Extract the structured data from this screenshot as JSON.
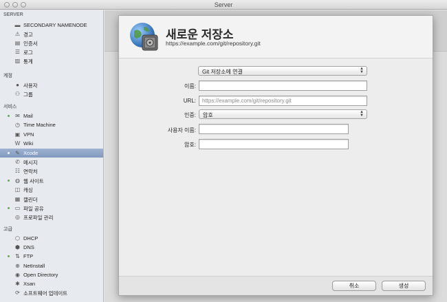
{
  "window": {
    "title": "Server"
  },
  "sidebar": {
    "server_header": "SERVER",
    "server_items": [
      {
        "label": "SECONDARY NAMENODE",
        "icon": "server-icon"
      },
      {
        "label": "경고",
        "icon": "alerts-icon"
      },
      {
        "label": "인증서",
        "icon": "certificates-icon"
      },
      {
        "label": "로그",
        "icon": "logs-icon"
      },
      {
        "label": "통계",
        "icon": "stats-icon"
      }
    ],
    "accounts_header": "계정",
    "accounts_items": [
      {
        "label": "사용자",
        "icon": "user-icon"
      },
      {
        "label": "그룹",
        "icon": "group-icon"
      }
    ],
    "services_header": "서비스",
    "services_items": [
      {
        "label": "Mail",
        "icon": "mail-icon",
        "active": true
      },
      {
        "label": "Time Machine",
        "icon": "time-machine-icon",
        "active": false
      },
      {
        "label": "VPN",
        "icon": "vpn-icon",
        "active": false
      },
      {
        "label": "Wiki",
        "icon": "wiki-icon",
        "active": false
      },
      {
        "label": "Xcode",
        "icon": "xcode-icon",
        "active": true,
        "selected": true
      },
      {
        "label": "메시지",
        "icon": "messages-icon",
        "active": false
      },
      {
        "label": "연락처",
        "icon": "contacts-icon",
        "active": false
      },
      {
        "label": "웹 사이트",
        "icon": "websites-icon",
        "active": true
      },
      {
        "label": "캐싱",
        "icon": "caching-icon",
        "active": false
      },
      {
        "label": "캘린더",
        "icon": "calendar-icon",
        "active": false
      },
      {
        "label": "파일 공유",
        "icon": "file-sharing-icon",
        "active": true
      },
      {
        "label": "프로파일 관리",
        "icon": "profile-manager-icon",
        "active": false
      }
    ],
    "advanced_header": "고급",
    "advanced_items": [
      {
        "label": "DHCP",
        "icon": "dhcp-icon",
        "active": false
      },
      {
        "label": "DNS",
        "icon": "dns-icon",
        "active": false
      },
      {
        "label": "FTP",
        "icon": "ftp-icon",
        "active": true
      },
      {
        "label": "NetInstall",
        "icon": "netinstall-icon",
        "active": false
      },
      {
        "label": "Open Directory",
        "icon": "open-directory-icon",
        "active": false
      },
      {
        "label": "Xsan",
        "icon": "xsan-icon",
        "active": false
      },
      {
        "label": "소프트웨어 업데이트",
        "icon": "software-update-icon",
        "active": false
      }
    ]
  },
  "sheet": {
    "title": "새로운 저장소",
    "subtitle": "https://example.com/git/repository.git",
    "icon": "repository-safe-icon",
    "action_popup": "Git 저장소에 연결",
    "name_label": "이름:",
    "name_value": "",
    "url_label": "URL:",
    "url_placeholder": "https://example.com/git/repository.git",
    "auth_label": "인증:",
    "auth_value": "암호",
    "username_label": "사용자 이름:",
    "username_value": "",
    "password_label": "암호:",
    "password_value": "",
    "cancel_label": "취소",
    "create_label": "생성"
  },
  "colors": {
    "selection": "#8da3c8",
    "active_dot": "#5ab04a"
  }
}
